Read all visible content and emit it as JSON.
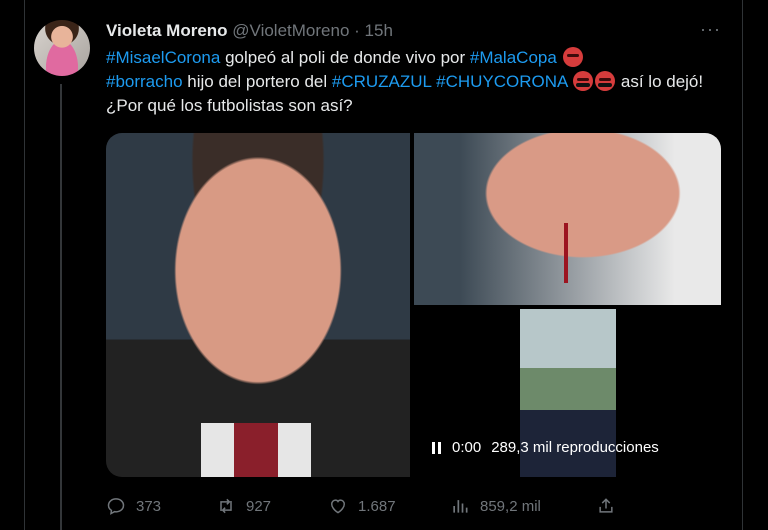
{
  "tweet": {
    "author_name": "Violeta Moreno",
    "author_handle": "@VioletMoreno",
    "separator": "·",
    "time_ago": "15h",
    "more": "···",
    "text": {
      "t1": "#MisaelCorona",
      "t2": " golpeó al poli de donde vivo por ",
      "t3": "#MalaCopa",
      "t4": "#borracho",
      "t5": " hijo del portero del ",
      "t6": "#CRUZAZUL",
      "t7": " ",
      "t8": "#CHUYCORONA",
      "t9": " así lo dejó! ¿Por qué los futbolistas son así?"
    },
    "emojis": [
      "angry-face",
      "cursing-face",
      "cursing-face"
    ]
  },
  "video": {
    "time": "0:00",
    "views": "289,3 mil reproducciones"
  },
  "actions": {
    "replies": "373",
    "retweets": "927",
    "likes": "1.687",
    "views": "859,2 mil"
  },
  "colors": {
    "background": "#000000",
    "text": "#e7e9ea",
    "muted": "#71767b",
    "accent": "#1d9bf0"
  }
}
